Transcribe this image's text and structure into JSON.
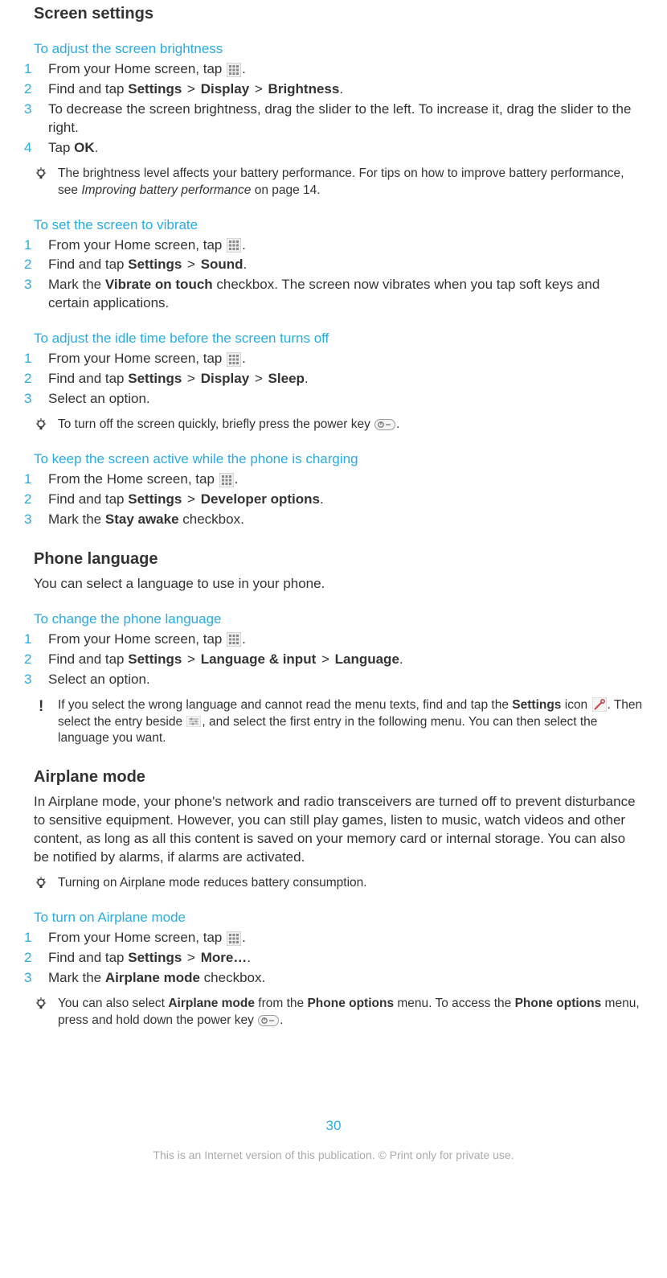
{
  "screen_settings": {
    "heading": "Screen settings",
    "brightness": {
      "title": "To adjust the screen brightness",
      "steps": [
        {
          "n": "1",
          "pre": "From your Home screen, tap ",
          "post": "."
        },
        {
          "n": "2",
          "pre": "Find and tap ",
          "b1": "Settings",
          "gt1": " > ",
          "b2": "Display",
          "gt2": " > ",
          "b3": "Brightness",
          "post": "."
        },
        {
          "n": "3",
          "pre": "To decrease the screen brightness, drag the slider to the left. To increase it, drag the slider to the right."
        },
        {
          "n": "4",
          "pre": "Tap ",
          "b1": "OK",
          "post": "."
        }
      ],
      "tip_pre": "The brightness level affects your battery performance. For tips on how to improve battery performance, see ",
      "tip_i": "Improving battery performance",
      "tip_post": " on page 14."
    },
    "vibrate": {
      "title": "To set the screen to vibrate",
      "steps": [
        {
          "n": "1",
          "pre": "From your Home screen, tap ",
          "post": "."
        },
        {
          "n": "2",
          "pre": "Find and tap ",
          "b1": "Settings",
          "gt1": " > ",
          "b2": "Sound",
          "post": "."
        },
        {
          "n": "3",
          "pre": "Mark the ",
          "b1": "Vibrate on touch",
          "post": " checkbox. The screen now vibrates when you tap soft keys and certain applications."
        }
      ]
    },
    "idle": {
      "title": "To adjust the idle time before the screen turns off",
      "steps": [
        {
          "n": "1",
          "pre": "From your Home screen, tap ",
          "post": "."
        },
        {
          "n": "2",
          "pre": "Find and tap ",
          "b1": "Settings",
          "gt1": " > ",
          "b2": "Display",
          "gt2": " > ",
          "b3": "Sleep",
          "post": "."
        },
        {
          "n": "3",
          "pre": "Select an option."
        }
      ],
      "tip_pre": "To turn off the screen quickly, briefly press the power key ",
      "tip_post": "."
    },
    "charging": {
      "title": "To keep the screen active while the phone is charging",
      "steps": [
        {
          "n": "1",
          "pre": "From the Home screen, tap ",
          "post": "."
        },
        {
          "n": "2",
          "pre": "Find and tap ",
          "b1": "Settings",
          "gt1": " > ",
          "b2": "Developer options",
          "post": "."
        },
        {
          "n": "3",
          "pre": "Mark the ",
          "b1": "Stay awake",
          "post": " checkbox."
        }
      ]
    }
  },
  "language": {
    "heading": "Phone language",
    "intro": "You can select a language to use in your phone.",
    "change": {
      "title": "To change the phone language",
      "steps": [
        {
          "n": "1",
          "pre": "From your Home screen, tap ",
          "post": "."
        },
        {
          "n": "2",
          "pre": "Find and tap ",
          "b1": "Settings",
          "gt1": " > ",
          "b2": "Language & input",
          "gt2": " > ",
          "b3": "Language",
          "post": "."
        },
        {
          "n": "3",
          "pre": "Select an option."
        }
      ],
      "warn_pre": "If you select the wrong language and cannot read the menu texts, find and tap the ",
      "warn_b1": "Settings",
      "warn_mid1": " icon ",
      "warn_mid2": ". Then select the entry beside ",
      "warn_post": ", and select the first entry in the following menu. You can then select the language you want."
    }
  },
  "airplane": {
    "heading": "Airplane mode",
    "intro": "In Airplane mode, your phone's network and radio transceivers are turned off to prevent disturbance to sensitive equipment. However, you can still play games, listen to music, watch videos and other content, as long as all this content is saved on your memory card or internal storage. You can also be notified by alarms, if alarms are activated.",
    "tip1": "Turning on Airplane mode reduces battery consumption.",
    "on": {
      "title": "To turn on Airplane mode",
      "steps": [
        {
          "n": "1",
          "pre": "From your Home screen, tap ",
          "post": "."
        },
        {
          "n": "2",
          "pre": "Find and tap ",
          "b1": "Settings",
          "gt1": " > ",
          "b2": "More…",
          "post": "."
        },
        {
          "n": "3",
          "pre": "Mark the ",
          "b1": "Airplane mode",
          "post": " checkbox."
        }
      ],
      "tip2_pre": "You can also select ",
      "tip2_b1": "Airplane mode",
      "tip2_mid1": " from the ",
      "tip2_b2": "Phone options",
      "tip2_mid2": " menu. To access the ",
      "tip2_b3": "Phone options",
      "tip2_post": " menu, press and hold down the power key ",
      "tip2_end": "."
    }
  },
  "footer": {
    "page": "30",
    "disclaimer": "This is an Internet version of this publication. © Print only for private use."
  }
}
